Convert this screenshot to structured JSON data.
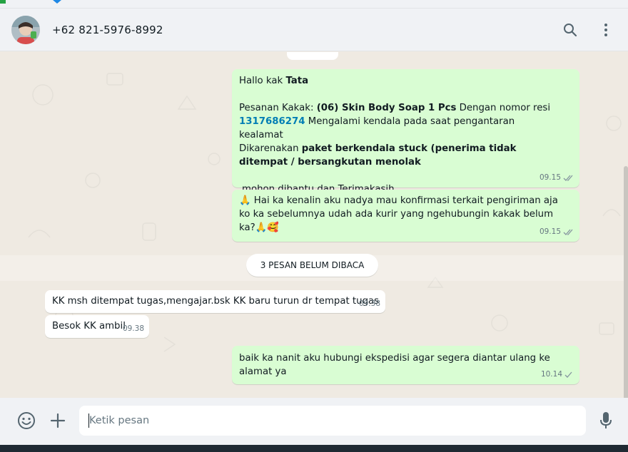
{
  "header": {
    "contact_name": "+62 821-5976-8992",
    "search_icon": "search-icon",
    "menu_icon": "more-vertical-icon"
  },
  "messages": [
    {
      "direction": "outgoing",
      "greeting_prefix": "Hallo kak ",
      "greeting_name": "Tata",
      "order_prefix": "Pesanan Kakak: ",
      "order_item": "(06) Skin Body Soap 1 Pcs",
      "order_mid": " Dengan nomor resi",
      "tracking_number": "1317686274",
      "order_issue": " Mengalami kendala pada saat pengantaran kealamat",
      "reason_prefix": "Dikarenakan ",
      "reason_bold": "paket berkendala stuck (penerima tidak ditempat / bersangkutan menolak",
      "closing": "mohon dibantu dan Terimakasih",
      "time": "09.15",
      "status": "read"
    },
    {
      "direction": "outgoing",
      "emoji_start": "🙏",
      "text": "Hai ka kenalin aku nadya mau konfirmasi terkait pengiriman aja ko ka sebelumnya udah ada kurir yang ngehubungin kakak belum ka?",
      "emoji_end": "🙏🥰",
      "time": "09.15",
      "status": "read"
    },
    {
      "direction": "incoming",
      "text": "KK msh ditempat tugas,mengajar.bsk KK baru turun dr tempat tugas",
      "time": "09.38"
    },
    {
      "direction": "incoming",
      "text": "Besok KK ambil",
      "time": "09.38"
    },
    {
      "direction": "outgoing",
      "text": "baik ka nanit aku hubungi ekspedisi agar segera diantar ulang ke alamat ya",
      "time": "10.14",
      "status": "sent"
    }
  ],
  "unread_divider": "3 PESAN BELUM DIBACA",
  "composer": {
    "placeholder": "Ketik pesan",
    "emoji_icon": "emoji-icon",
    "attach_icon": "plus-icon",
    "mic_icon": "microphone-icon"
  },
  "colors": {
    "outgoing_bubble": "#d9fdd3",
    "incoming_bubble": "#ffffff",
    "chat_background": "#efeae2",
    "link": "#027eb5",
    "read_ticks": "#8696a0"
  }
}
